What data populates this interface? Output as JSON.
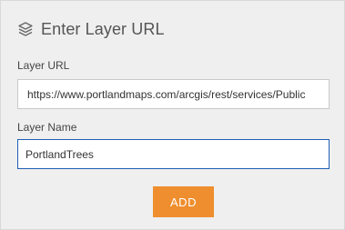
{
  "header": {
    "title": "Enter Layer URL",
    "icon": "layers-icon"
  },
  "form": {
    "url_label": "Layer URL",
    "url_value": "https://www.portlandmaps.com/arcgis/rest/services/Public",
    "name_label": "Layer Name",
    "name_value": "PortlandTrees"
  },
  "actions": {
    "add_label": "ADD"
  },
  "colors": {
    "accent": "#ef8e2e",
    "focus_border": "#1f5fb5"
  }
}
